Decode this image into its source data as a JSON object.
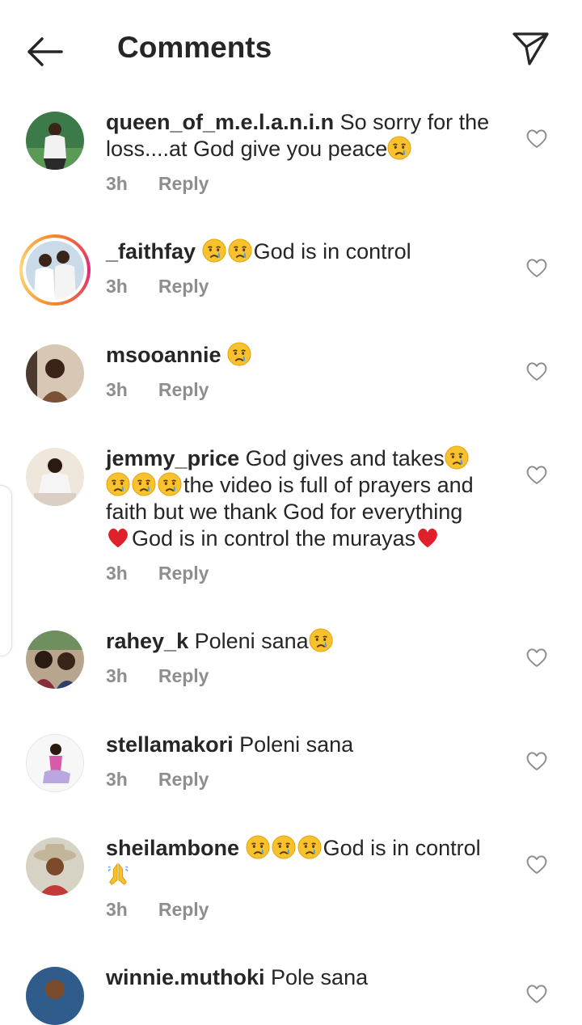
{
  "header": {
    "title": "Comments",
    "back_icon": "arrow-left-icon",
    "share_icon": "paper-plane-icon"
  },
  "icons": {
    "crying": "crying-face-emoji",
    "heart_red": "red-heart-emoji",
    "pray": "folded-hands-emoji",
    "like": "heart-outline-icon"
  },
  "comments": [
    {
      "username": "queen_of_m.e.l.a.n.i.n",
      "text_line1": " So sorry for the",
      "text_line2": "loss....at God give you peace",
      "time": "3h",
      "reply": "Reply"
    },
    {
      "username": "_faithfay",
      "text": "God is in control",
      "time": "3h",
      "reply": "Reply"
    },
    {
      "username": "msooannie",
      "time": "3h",
      "reply": "Reply"
    },
    {
      "username": "jemmy_price",
      "text_line1": " God gives and takes",
      "text_line2": "the video is full of prayers and",
      "text_line3": "faith but we thank God for everything",
      "text_line4": "God is in control the murayas",
      "time": "3h",
      "reply": "Reply"
    },
    {
      "username": "rahey_k",
      "text": " Poleni sana",
      "time": "3h",
      "reply": "Reply"
    },
    {
      "username": "stellamakori",
      "text": " Poleni sana",
      "time": "3h",
      "reply": "Reply"
    },
    {
      "username": "sheilambone",
      "text": "God is in control",
      "time": "3h",
      "reply": "Reply"
    },
    {
      "username": "winnie.muthoki",
      "text": " Pole sana"
    }
  ],
  "colors": {
    "text": "#262626",
    "meta": "#8e8e8e",
    "story_ring_start": "#f58529",
    "story_ring_end": "#dd2a7b"
  }
}
